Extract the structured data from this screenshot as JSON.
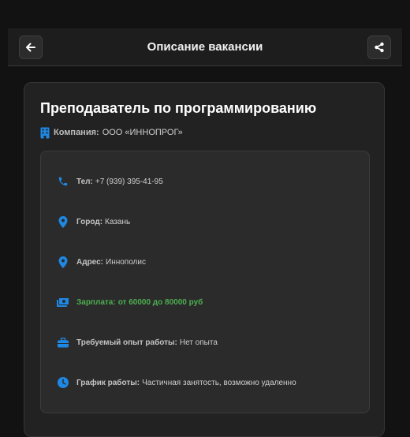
{
  "header": {
    "title": "Описание вакансии",
    "back_icon": "arrow-left-icon",
    "share_icon": "share-icon"
  },
  "vacancy": {
    "title": "Преподаватель по программированию",
    "company_label": "Компания:",
    "company_value": "ООО «ИННОПРОГ»",
    "company_icon": "building-icon"
  },
  "details": [
    {
      "icon": "phone-icon",
      "label": "Тел:",
      "value": "+7 (939) 395-41-95"
    },
    {
      "icon": "map-pin-icon",
      "label": "Город:",
      "value": "Казань"
    },
    {
      "icon": "map-pin-icon",
      "label": "Адрес:",
      "value": "Иннополис"
    },
    {
      "icon": "money-icon",
      "label": "Зарплата:",
      "value": "от 60000 до 80000 руб"
    },
    {
      "icon": "briefcase-icon",
      "label": "Требуемый опыт работы:",
      "value": "Нет опыта"
    },
    {
      "icon": "clock-icon",
      "label": "График работы:",
      "value": "Частичная занятость, возможно удаленно"
    }
  ],
  "colors": {
    "accent": "#1e88e5",
    "salary": "#4caf50",
    "background": "#121212",
    "card": "#222222"
  }
}
